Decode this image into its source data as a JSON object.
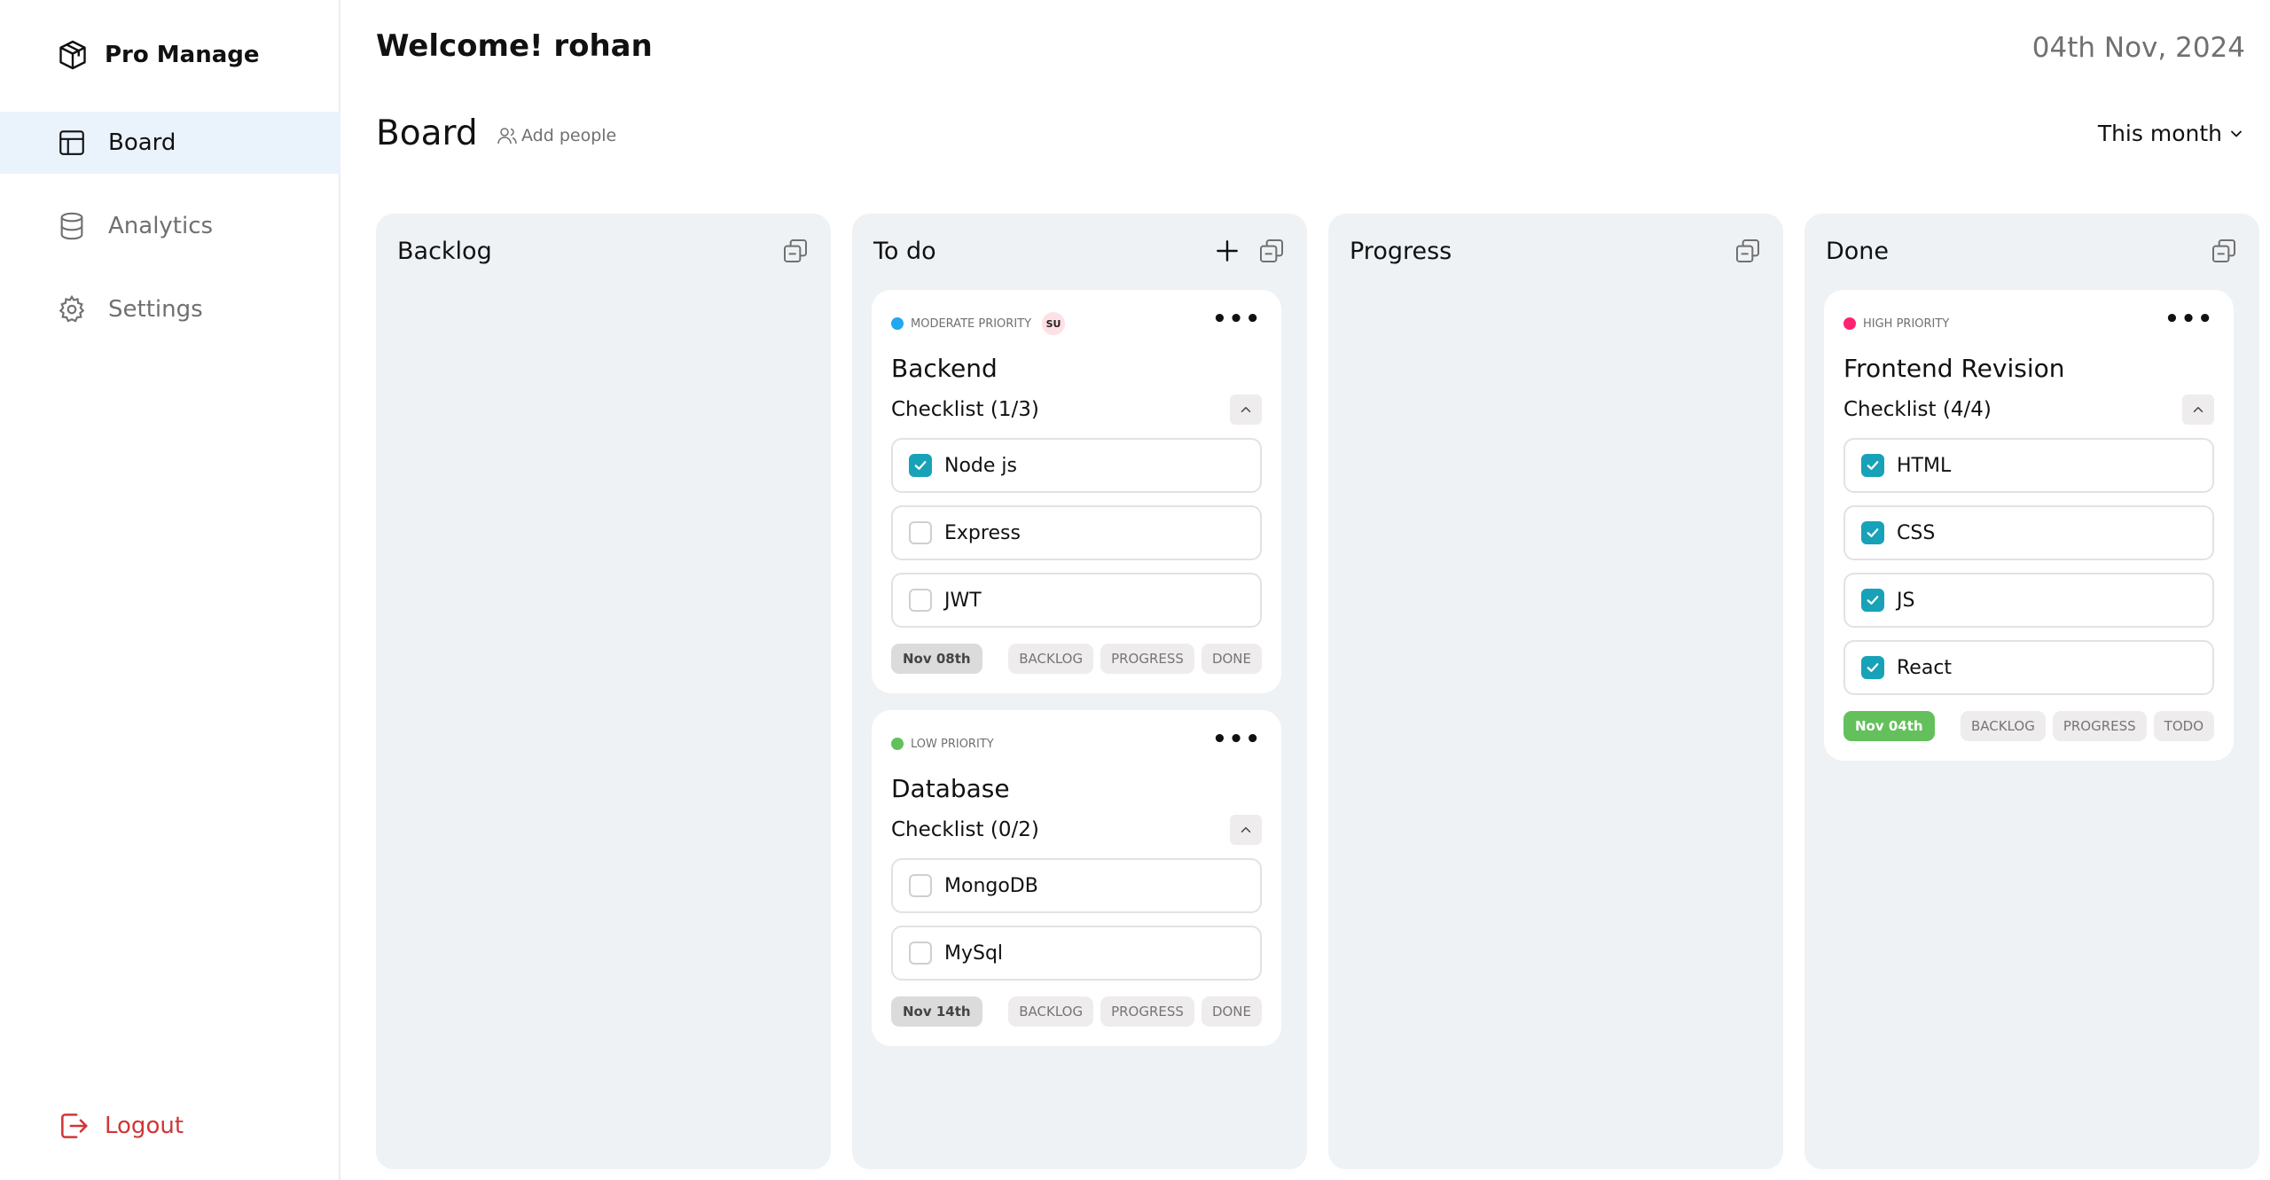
{
  "sidebar": {
    "brand": "Pro Manage",
    "items": [
      {
        "label": "Board",
        "icon": "layout-icon",
        "active": true
      },
      {
        "label": "Analytics",
        "icon": "database-icon",
        "active": false
      },
      {
        "label": "Settings",
        "icon": "gear-icon",
        "active": false
      }
    ],
    "logout": "Logout"
  },
  "header": {
    "welcome": "Welcome! rohan",
    "date": "04th Nov, 2024",
    "board_title": "Board",
    "add_people": "Add people",
    "filter": "This month"
  },
  "columns": [
    {
      "title": "Backlog"
    },
    {
      "title": "To do"
    },
    {
      "title": "Progress"
    },
    {
      "title": "Done"
    }
  ],
  "cards": {
    "backend": {
      "priority": "MODERATE PRIORITY",
      "assignee": "SU",
      "title": "Backend",
      "checklist": "Checklist (1/3)",
      "items": [
        {
          "label": "Node js",
          "done": true
        },
        {
          "label": "Express",
          "done": false
        },
        {
          "label": "JWT",
          "done": false
        }
      ],
      "due": "Nov 08th",
      "moves": [
        "BACKLOG",
        "PROGRESS",
        "DONE"
      ]
    },
    "database": {
      "priority": "LOW PRIORITY",
      "title": "Database",
      "checklist": "Checklist (0/2)",
      "items": [
        {
          "label": "MongoDB",
          "done": false
        },
        {
          "label": "MySql",
          "done": false
        }
      ],
      "due": "Nov 14th",
      "moves": [
        "BACKLOG",
        "PROGRESS",
        "DONE"
      ]
    },
    "frontend": {
      "priority": "HIGH PRIORITY",
      "title": "Frontend Revision",
      "checklist": "Checklist (4/4)",
      "items": [
        {
          "label": "HTML",
          "done": true
        },
        {
          "label": "CSS",
          "done": true
        },
        {
          "label": "JS",
          "done": true
        },
        {
          "label": "React",
          "done": true
        }
      ],
      "due": "Nov 04th",
      "moves": [
        "BACKLOG",
        "PROGRESS",
        "TODO"
      ]
    }
  },
  "colors": {
    "moderate": "#22a7f0",
    "low": "#63c05b",
    "high": "#ff2473",
    "checked": "#17a2b8",
    "active_nav": "#eaf3fc",
    "column_bg": "#eef2f5",
    "logout": "#cf3636"
  }
}
